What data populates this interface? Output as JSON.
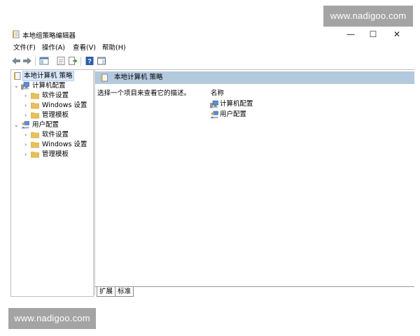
{
  "watermark_text": "www.nadigoo.com",
  "window": {
    "title": "本地组策略编辑器",
    "controls": {
      "minimize": "—",
      "maximize": "☐",
      "close": "✕"
    }
  },
  "menu": [
    "文件(F)",
    "操作(A)",
    "查看(V)",
    "帮助(H)"
  ],
  "toolbar": {
    "icons": [
      "back-icon",
      "forward-icon",
      "show-hide-tree-icon",
      "properties-icon",
      "export-list-icon",
      "help-icon",
      "show-action-pane-icon"
    ]
  },
  "tree": {
    "root": "本地计算机 策略",
    "computer_config": "计算机配置",
    "computer_children": [
      "软件设置",
      "Windows 设置",
      "管理模板"
    ],
    "user_config": "用户配置",
    "user_children": [
      "软件设置",
      "Windows 设置",
      "管理模板"
    ]
  },
  "detail": {
    "header_title": "本地计算机 策略",
    "description": "选择一个项目来查看它的描述。",
    "column_name": "名称",
    "items": [
      "计算机配置",
      "用户配置"
    ]
  },
  "tabs": [
    "扩展",
    "标准"
  ],
  "colors": {
    "header_bg": "#b3c9de",
    "selection_bg": "#d9e8fb",
    "folder": "#e8c15a",
    "watermark_bg": "#a4a4a4"
  }
}
